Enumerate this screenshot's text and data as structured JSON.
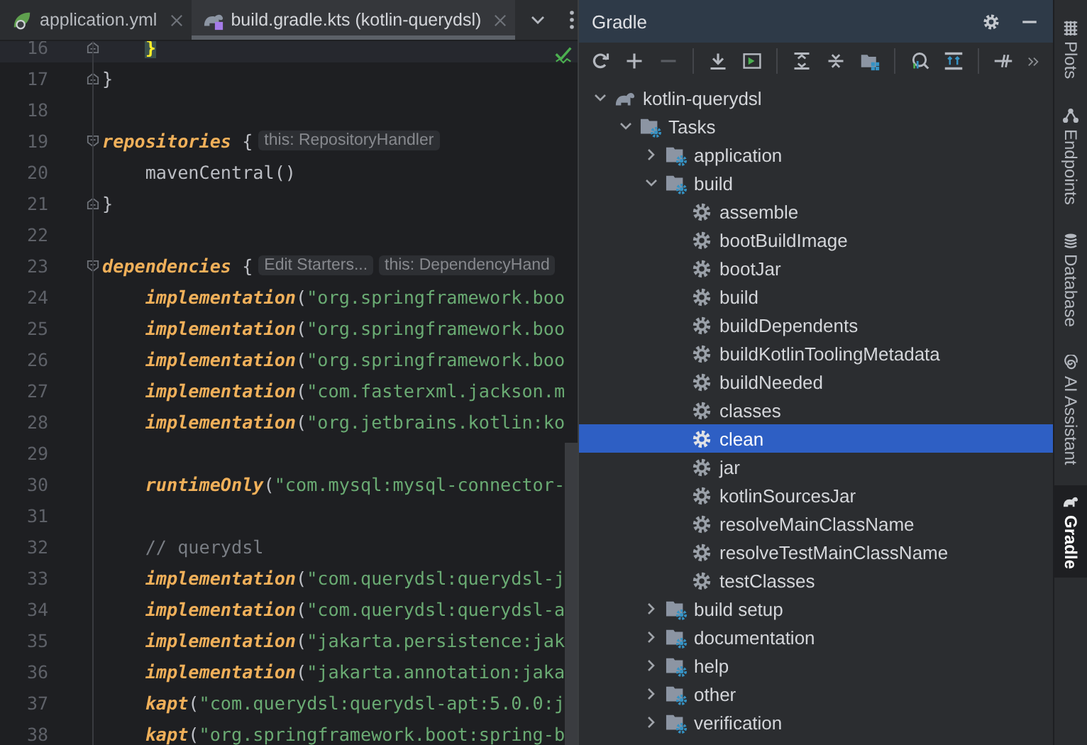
{
  "editor": {
    "tabs": [
      {
        "label": "application.yml",
        "kind": "yaml",
        "selected": false
      },
      {
        "label": "build.gradle.kts (kotlin-querydsl)",
        "kind": "gradle",
        "selected": true
      }
    ],
    "lines": [
      {
        "num": "16",
        "kind": "close",
        "current": true,
        "indented": true,
        "code": [
          {
            "kind": "brace",
            "text": "}"
          }
        ]
      },
      {
        "num": "17",
        "kind": "close",
        "current": false,
        "indented": false,
        "code": [
          {
            "kind": "plain",
            "text": "}"
          }
        ]
      },
      {
        "num": "18",
        "kind": "code",
        "current": false
      },
      {
        "num": "19",
        "kind": "open",
        "current": false,
        "indented": false,
        "code": [
          {
            "kind": "keyword",
            "text": "repositories"
          },
          {
            "kind": "plain",
            "text": " {"
          }
        ],
        "hints": [
          "this: RepositoryHandler"
        ]
      },
      {
        "num": "20",
        "kind": "code",
        "current": false,
        "indented": true,
        "code": [
          {
            "kind": "plain",
            "text": "mavenCentral()"
          }
        ]
      },
      {
        "num": "21",
        "kind": "close",
        "current": false,
        "indented": false,
        "code": [
          {
            "kind": "plain",
            "text": "}"
          }
        ]
      },
      {
        "num": "22",
        "kind": "code",
        "current": false
      },
      {
        "num": "23",
        "kind": "open",
        "current": false,
        "indented": false,
        "code": [
          {
            "kind": "keyword",
            "text": "dependencies"
          },
          {
            "kind": "plain",
            "text": " {"
          }
        ],
        "hints": [
          "Edit Starters...",
          "this: DependencyHand"
        ]
      },
      {
        "num": "24",
        "kind": "code",
        "current": false,
        "indented": true,
        "code": [
          {
            "kind": "keyword",
            "text": "implementation"
          },
          {
            "kind": "plain",
            "text": "("
          },
          {
            "kind": "string",
            "text": "\"org.springframework.boo"
          }
        ]
      },
      {
        "num": "25",
        "kind": "code",
        "current": false,
        "indented": true,
        "code": [
          {
            "kind": "keyword",
            "text": "implementation"
          },
          {
            "kind": "plain",
            "text": "("
          },
          {
            "kind": "string",
            "text": "\"org.springframework.boo"
          }
        ]
      },
      {
        "num": "26",
        "kind": "code",
        "current": false,
        "indented": true,
        "code": [
          {
            "kind": "keyword",
            "text": "implementation"
          },
          {
            "kind": "plain",
            "text": "("
          },
          {
            "kind": "string",
            "text": "\"org.springframework.boo"
          }
        ]
      },
      {
        "num": "27",
        "kind": "code",
        "current": false,
        "indented": true,
        "code": [
          {
            "kind": "keyword",
            "text": "implementation"
          },
          {
            "kind": "plain",
            "text": "("
          },
          {
            "kind": "string",
            "text": "\"com.fasterxml.jackson.m"
          }
        ]
      },
      {
        "num": "28",
        "kind": "code",
        "current": false,
        "indented": true,
        "code": [
          {
            "kind": "keyword",
            "text": "implementation"
          },
          {
            "kind": "plain",
            "text": "("
          },
          {
            "kind": "string",
            "text": "\"org.jetbrains.kotlin:ko"
          }
        ]
      },
      {
        "num": "29",
        "kind": "code",
        "current": false
      },
      {
        "num": "30",
        "kind": "code",
        "current": false,
        "indented": true,
        "code": [
          {
            "kind": "keyword",
            "text": "runtimeOnly"
          },
          {
            "kind": "plain",
            "text": "("
          },
          {
            "kind": "string",
            "text": "\"com.mysql:mysql-connector-"
          }
        ]
      },
      {
        "num": "31",
        "kind": "code",
        "current": false
      },
      {
        "num": "32",
        "kind": "code",
        "current": false,
        "indented": true,
        "code": [
          {
            "kind": "comment",
            "text": "// querydsl"
          }
        ]
      },
      {
        "num": "33",
        "kind": "code",
        "current": false,
        "indented": true,
        "code": [
          {
            "kind": "keyword",
            "text": "implementation"
          },
          {
            "kind": "plain",
            "text": "("
          },
          {
            "kind": "string",
            "text": "\"com.querydsl:querydsl-j"
          }
        ]
      },
      {
        "num": "34",
        "kind": "code",
        "current": false,
        "indented": true,
        "code": [
          {
            "kind": "keyword",
            "text": "implementation"
          },
          {
            "kind": "plain",
            "text": "("
          },
          {
            "kind": "string",
            "text": "\"com.querydsl:querydsl-a"
          }
        ]
      },
      {
        "num": "35",
        "kind": "code",
        "current": false,
        "indented": true,
        "code": [
          {
            "kind": "keyword",
            "text": "implementation"
          },
          {
            "kind": "plain",
            "text": "("
          },
          {
            "kind": "string",
            "text": "\"jakarta.persistence:jak"
          }
        ]
      },
      {
        "num": "36",
        "kind": "code",
        "current": false,
        "indented": true,
        "code": [
          {
            "kind": "keyword",
            "text": "implementation"
          },
          {
            "kind": "plain",
            "text": "("
          },
          {
            "kind": "string",
            "text": "\"jakarta.annotation:jaka"
          }
        ]
      },
      {
        "num": "37",
        "kind": "code",
        "current": false,
        "indented": true,
        "code": [
          {
            "kind": "keyword",
            "text": "kapt"
          },
          {
            "kind": "plain",
            "text": "("
          },
          {
            "kind": "string",
            "text": "\"com.querydsl:querydsl-apt:5.0.0:j"
          }
        ]
      },
      {
        "num": "38",
        "kind": "code",
        "current": false,
        "indented": true,
        "code": [
          {
            "kind": "keyword",
            "text": "kapt"
          },
          {
            "kind": "plain",
            "text": "("
          },
          {
            "kind": "string",
            "text": "\"org.springframework.boot:spring-b"
          }
        ]
      }
    ]
  },
  "gradle": {
    "title": "Gradle",
    "tree": [
      {
        "label": "kotlin-querydsl",
        "kind": "project",
        "expanded": true,
        "selected": false,
        "children": [
          {
            "label": "Tasks",
            "kind": "group",
            "expanded": true,
            "selected": false,
            "children": [
              {
                "label": "application",
                "kind": "group",
                "expanded": false,
                "selected": false
              },
              {
                "label": "build",
                "kind": "group",
                "expanded": true,
                "selected": false,
                "children": [
                  {
                    "label": "assemble",
                    "kind": "task",
                    "selected": false
                  },
                  {
                    "label": "bootBuildImage",
                    "kind": "task",
                    "selected": false
                  },
                  {
                    "label": "bootJar",
                    "kind": "task",
                    "selected": false
                  },
                  {
                    "label": "build",
                    "kind": "task",
                    "selected": false
                  },
                  {
                    "label": "buildDependents",
                    "kind": "task",
                    "selected": false
                  },
                  {
                    "label": "buildKotlinToolingMetadata",
                    "kind": "task",
                    "selected": false
                  },
                  {
                    "label": "buildNeeded",
                    "kind": "task",
                    "selected": false
                  },
                  {
                    "label": "classes",
                    "kind": "task",
                    "selected": false
                  },
                  {
                    "label": "clean",
                    "kind": "task",
                    "selected": true
                  },
                  {
                    "label": "jar",
                    "kind": "task",
                    "selected": false
                  },
                  {
                    "label": "kotlinSourcesJar",
                    "kind": "task",
                    "selected": false
                  },
                  {
                    "label": "resolveMainClassName",
                    "kind": "task",
                    "selected": false
                  },
                  {
                    "label": "resolveTestMainClassName",
                    "kind": "task",
                    "selected": false
                  },
                  {
                    "label": "testClasses",
                    "kind": "task",
                    "selected": false
                  }
                ]
              },
              {
                "label": "build setup",
                "kind": "group",
                "expanded": false,
                "selected": false
              },
              {
                "label": "documentation",
                "kind": "group",
                "expanded": false,
                "selected": false
              },
              {
                "label": "help",
                "kind": "group",
                "expanded": false,
                "selected": false
              },
              {
                "label": "other",
                "kind": "group",
                "expanded": false,
                "selected": false
              },
              {
                "label": "verification",
                "kind": "group",
                "expanded": false,
                "selected": false
              }
            ]
          }
        ]
      }
    ]
  },
  "side_tools": [
    {
      "label": "Plots",
      "kind": "plots",
      "selected": false
    },
    {
      "label": "Endpoints",
      "kind": "endpoints",
      "selected": false
    },
    {
      "label": "Database",
      "kind": "database",
      "selected": false
    },
    {
      "label": "AI Assistant",
      "kind": "assistant",
      "selected": false
    },
    {
      "label": "Gradle",
      "kind": "gradle",
      "selected": true
    }
  ]
}
